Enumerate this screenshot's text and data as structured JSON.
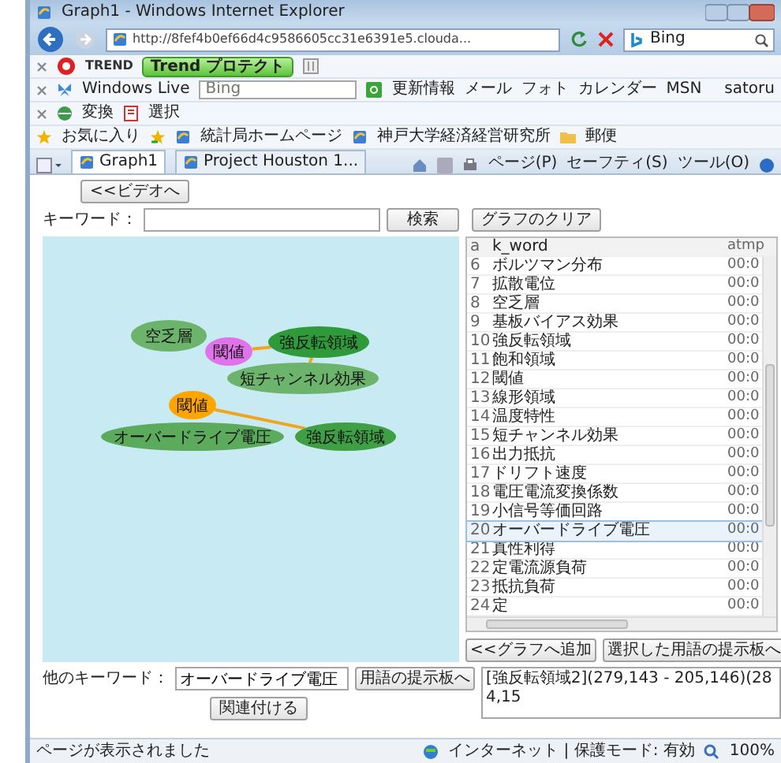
{
  "window": {
    "title": "Graph1 - Windows Internet Explorer"
  },
  "address_bar": {
    "url": "http://8fef4b0ef66d4c9586605cc31e6391e5.clouda...",
    "search_value": "Bing"
  },
  "trend_toolbar": {
    "logo": "TREND",
    "protect_button": "Trend プロテクト"
  },
  "live_toolbar": {
    "brand": "Windows Live",
    "search_placeholder": "Bing",
    "links": [
      "更新情報",
      "メール",
      "フォト",
      "カレンダー",
      "MSN"
    ],
    "user": "satoru"
  },
  "translate_toolbar": {
    "items": [
      "変換",
      "選択"
    ]
  },
  "favorites_bar": {
    "favorites": "お気に入り",
    "links": [
      "統計局ホームページ",
      "神戸大学経済経営研究所",
      "郵便"
    ]
  },
  "tabs": [
    {
      "label": "Graph1",
      "selected": true
    },
    {
      "label": "Project Houston 1...",
      "selected": false
    }
  ],
  "command_bar": [
    "ページ(P)",
    "セーフティ(S)",
    "ツール(O)"
  ],
  "page": {
    "video_button": "<<ビデオへ",
    "keyword_label": "キーワード：",
    "search_button": "検索",
    "clear_button": "グラフのクリア",
    "graph": {
      "nodes": [
        {
          "label": "空乏層",
          "color": "#6cb36c"
        },
        {
          "label": "閾値",
          "color": "#e073ea"
        },
        {
          "label": "強反転領域",
          "color": "#2f9a3a"
        },
        {
          "label": "短チャンネル効果",
          "color": "#6cb36c"
        },
        {
          "label": "閾値",
          "color": "#ffa500"
        },
        {
          "label": "オーバードライブ電圧",
          "color": "#5caa5c"
        },
        {
          "label": "強反転領域",
          "color": "#3f9f45"
        }
      ]
    },
    "table": {
      "columns": [
        "a",
        "k_word",
        "atmp"
      ],
      "rows": [
        {
          "a": "6",
          "k_word": "ボルツマン分布",
          "atmp": "00:0",
          "selected": false
        },
        {
          "a": "7",
          "k_word": "拡散電位",
          "atmp": "00:0",
          "selected": false
        },
        {
          "a": "8",
          "k_word": "空乏層",
          "atmp": "00:0",
          "selected": false
        },
        {
          "a": "9",
          "k_word": "基板バイアス効果",
          "atmp": "00:0",
          "selected": false
        },
        {
          "a": "10",
          "k_word": "強反転領域",
          "atmp": "00:0",
          "selected": false
        },
        {
          "a": "11",
          "k_word": "飽和領域",
          "atmp": "00:0",
          "selected": false
        },
        {
          "a": "12",
          "k_word": "閾値",
          "atmp": "00:0",
          "selected": false
        },
        {
          "a": "13",
          "k_word": "線形領域",
          "atmp": "00:0",
          "selected": false
        },
        {
          "a": "14",
          "k_word": "温度特性",
          "atmp": "00:0",
          "selected": false
        },
        {
          "a": "15",
          "k_word": "短チャンネル効果",
          "atmp": "00:0",
          "selected": false
        },
        {
          "a": "16",
          "k_word": "出力抵抗",
          "atmp": "00:0",
          "selected": false
        },
        {
          "a": "17",
          "k_word": "ドリフト速度",
          "atmp": "00:0",
          "selected": false
        },
        {
          "a": "18",
          "k_word": "電圧電流変換係数",
          "atmp": "00:0",
          "selected": false
        },
        {
          "a": "19",
          "k_word": "小信号等価回路",
          "atmp": "00:0",
          "selected": false
        },
        {
          "a": "20",
          "k_word": "オーバードライブ電圧",
          "atmp": "00:0",
          "selected": true
        },
        {
          "a": "21",
          "k_word": "真性利得",
          "atmp": "00:0",
          "selected": false
        },
        {
          "a": "22",
          "k_word": "定電流源負荷",
          "atmp": "00:0",
          "selected": false
        },
        {
          "a": "23",
          "k_word": "抵抗負荷",
          "atmp": "00:0",
          "selected": false
        },
        {
          "a": "24",
          "k_word": "定",
          "atmp": "00:0",
          "selected": false
        }
      ]
    },
    "add_button": "<<グラフへ追加",
    "board_button": "選択した用語の提示板へ",
    "other_keyword_label": "他のキーワード：",
    "other_keyword_value": "オーバードライブ電圧",
    "term_board_button": "用語の提示板へ",
    "relate_button": "関連付ける",
    "memo": "[強反転領域2](279,143 - 205,146)(284,15"
  },
  "status_bar": {
    "message": "ページが表示されました",
    "zone": "インターネット | 保護モード: 有効",
    "zoom": "100%"
  }
}
